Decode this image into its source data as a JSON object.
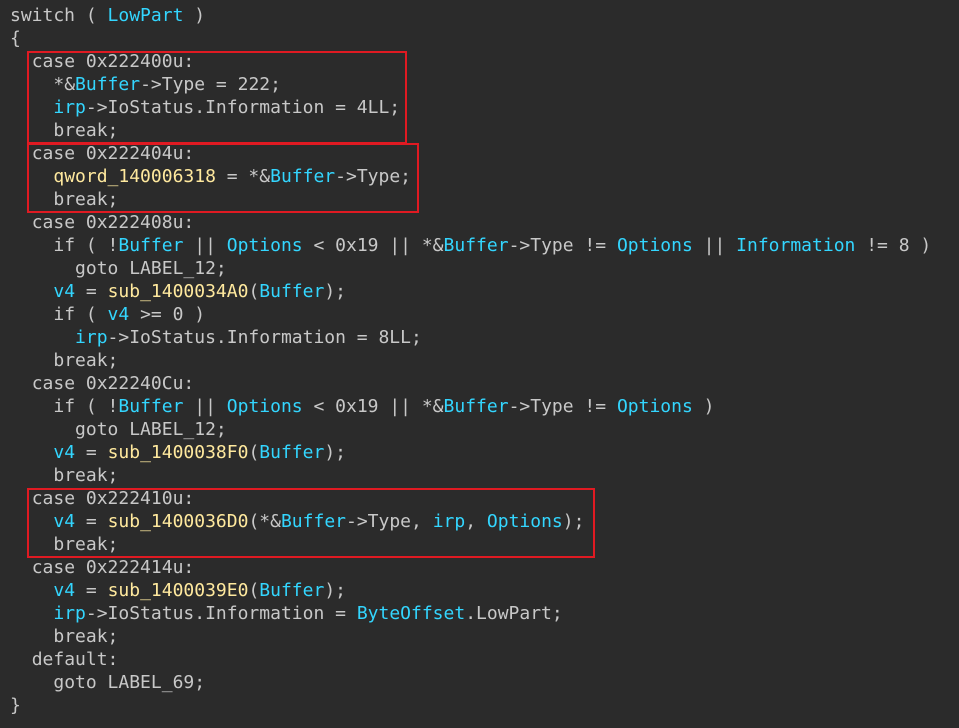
{
  "colors": {
    "background": "#2b2b2b",
    "default_text": "#c8c8c8",
    "variable": "#33d6ff",
    "function": "#ffe99e",
    "highlight_border": "#e01a22"
  },
  "code_lines": [
    {
      "indent": "",
      "tokens": [
        {
          "t": "switch ( ",
          "c": "kw"
        },
        {
          "t": "LowPart",
          "c": "var"
        },
        {
          "t": " )",
          "c": "kw"
        }
      ]
    },
    {
      "indent": "",
      "tokens": [
        {
          "t": "{",
          "c": "kw"
        }
      ]
    },
    {
      "indent": "  ",
      "tokens": [
        {
          "t": "case 0x222400u:",
          "c": "kw"
        }
      ]
    },
    {
      "indent": "    ",
      "tokens": [
        {
          "t": "*&",
          "c": "kw"
        },
        {
          "t": "Buffer",
          "c": "var"
        },
        {
          "t": "->Type = 222;",
          "c": "kw"
        }
      ]
    },
    {
      "indent": "    ",
      "tokens": [
        {
          "t": "irp",
          "c": "var"
        },
        {
          "t": "->IoStatus.Information = 4LL;",
          "c": "kw"
        }
      ]
    },
    {
      "indent": "    ",
      "tokens": [
        {
          "t": "break;",
          "c": "kw"
        }
      ]
    },
    {
      "indent": "  ",
      "tokens": [
        {
          "t": "case 0x222404u:",
          "c": "kw"
        }
      ]
    },
    {
      "indent": "    ",
      "tokens": [
        {
          "t": "qword_140006318",
          "c": "fn"
        },
        {
          "t": " = *&",
          "c": "kw"
        },
        {
          "t": "Buffer",
          "c": "var"
        },
        {
          "t": "->Type;",
          "c": "kw"
        }
      ]
    },
    {
      "indent": "    ",
      "tokens": [
        {
          "t": "break;",
          "c": "kw"
        }
      ]
    },
    {
      "indent": "  ",
      "tokens": [
        {
          "t": "case 0x222408u:",
          "c": "kw"
        }
      ]
    },
    {
      "indent": "    ",
      "tokens": [
        {
          "t": "if ( !",
          "c": "kw"
        },
        {
          "t": "Buffer",
          "c": "var"
        },
        {
          "t": " || ",
          "c": "kw"
        },
        {
          "t": "Options",
          "c": "var"
        },
        {
          "t": " < 0x19 || *&",
          "c": "kw"
        },
        {
          "t": "Buffer",
          "c": "var"
        },
        {
          "t": "->Type != ",
          "c": "kw"
        },
        {
          "t": "Options",
          "c": "var"
        },
        {
          "t": " || ",
          "c": "kw"
        },
        {
          "t": "Information",
          "c": "var"
        },
        {
          "t": " != 8 )",
          "c": "kw"
        }
      ]
    },
    {
      "indent": "      ",
      "tokens": [
        {
          "t": "goto LABEL_12;",
          "c": "kw"
        }
      ]
    },
    {
      "indent": "    ",
      "tokens": [
        {
          "t": "v4",
          "c": "var"
        },
        {
          "t": " = ",
          "c": "kw"
        },
        {
          "t": "sub_1400034A0",
          "c": "fn"
        },
        {
          "t": "(",
          "c": "kw"
        },
        {
          "t": "Buffer",
          "c": "var"
        },
        {
          "t": ");",
          "c": "kw"
        }
      ]
    },
    {
      "indent": "    ",
      "tokens": [
        {
          "t": "if ( ",
          "c": "kw"
        },
        {
          "t": "v4",
          "c": "var"
        },
        {
          "t": " >= 0 )",
          "c": "kw"
        }
      ]
    },
    {
      "indent": "      ",
      "tokens": [
        {
          "t": "irp",
          "c": "var"
        },
        {
          "t": "->IoStatus.Information = 8LL;",
          "c": "kw"
        }
      ]
    },
    {
      "indent": "    ",
      "tokens": [
        {
          "t": "break;",
          "c": "kw"
        }
      ]
    },
    {
      "indent": "  ",
      "tokens": [
        {
          "t": "case 0x22240Cu:",
          "c": "kw"
        }
      ]
    },
    {
      "indent": "    ",
      "tokens": [
        {
          "t": "if ( !",
          "c": "kw"
        },
        {
          "t": "Buffer",
          "c": "var"
        },
        {
          "t": " || ",
          "c": "kw"
        },
        {
          "t": "Options",
          "c": "var"
        },
        {
          "t": " < 0x19 || *&",
          "c": "kw"
        },
        {
          "t": "Buffer",
          "c": "var"
        },
        {
          "t": "->Type != ",
          "c": "kw"
        },
        {
          "t": "Options",
          "c": "var"
        },
        {
          "t": " )",
          "c": "kw"
        }
      ]
    },
    {
      "indent": "      ",
      "tokens": [
        {
          "t": "goto LABEL_12;",
          "c": "kw"
        }
      ]
    },
    {
      "indent": "    ",
      "tokens": [
        {
          "t": "v4",
          "c": "var"
        },
        {
          "t": " = ",
          "c": "kw"
        },
        {
          "t": "sub_1400038F0",
          "c": "fn"
        },
        {
          "t": "(",
          "c": "kw"
        },
        {
          "t": "Buffer",
          "c": "var"
        },
        {
          "t": ");",
          "c": "kw"
        }
      ]
    },
    {
      "indent": "    ",
      "tokens": [
        {
          "t": "break;",
          "c": "kw"
        }
      ]
    },
    {
      "indent": "  ",
      "tokens": [
        {
          "t": "case 0x222410u:",
          "c": "kw"
        }
      ]
    },
    {
      "indent": "    ",
      "tokens": [
        {
          "t": "v4",
          "c": "var"
        },
        {
          "t": " = ",
          "c": "kw"
        },
        {
          "t": "sub_1400036D0",
          "c": "fn"
        },
        {
          "t": "(*&",
          "c": "kw"
        },
        {
          "t": "Buffer",
          "c": "var"
        },
        {
          "t": "->Type, ",
          "c": "kw"
        },
        {
          "t": "irp",
          "c": "var"
        },
        {
          "t": ", ",
          "c": "kw"
        },
        {
          "t": "Options",
          "c": "var"
        },
        {
          "t": ");",
          "c": "kw"
        }
      ]
    },
    {
      "indent": "    ",
      "tokens": [
        {
          "t": "break;",
          "c": "kw"
        }
      ]
    },
    {
      "indent": "  ",
      "tokens": [
        {
          "t": "case 0x222414u:",
          "c": "kw"
        }
      ]
    },
    {
      "indent": "    ",
      "tokens": [
        {
          "t": "v4",
          "c": "var"
        },
        {
          "t": " = ",
          "c": "kw"
        },
        {
          "t": "sub_1400039E0",
          "c": "fn"
        },
        {
          "t": "(",
          "c": "kw"
        },
        {
          "t": "Buffer",
          "c": "var"
        },
        {
          "t": ");",
          "c": "kw"
        }
      ]
    },
    {
      "indent": "    ",
      "tokens": [
        {
          "t": "irp",
          "c": "var"
        },
        {
          "t": "->IoStatus.Information = ",
          "c": "kw"
        },
        {
          "t": "ByteOffset",
          "c": "var"
        },
        {
          "t": ".LowPart;",
          "c": "kw"
        }
      ]
    },
    {
      "indent": "    ",
      "tokens": [
        {
          "t": "break;",
          "c": "kw"
        }
      ]
    },
    {
      "indent": "  ",
      "tokens": [
        {
          "t": "default:",
          "c": "kw"
        }
      ]
    },
    {
      "indent": "    ",
      "tokens": [
        {
          "t": "goto LABEL_69;",
          "c": "kw"
        }
      ]
    },
    {
      "indent": "",
      "tokens": [
        {
          "t": "}",
          "c": "kw"
        }
      ]
    }
  ],
  "highlight_boxes": [
    {
      "label": "case 0x222400u:",
      "first_line": 2,
      "last_line": 5
    },
    {
      "label": "case 0x222404u:",
      "first_line": 6,
      "last_line": 8
    },
    {
      "label": "case 0x222410u:",
      "first_line": 21,
      "last_line": 23
    }
  ]
}
